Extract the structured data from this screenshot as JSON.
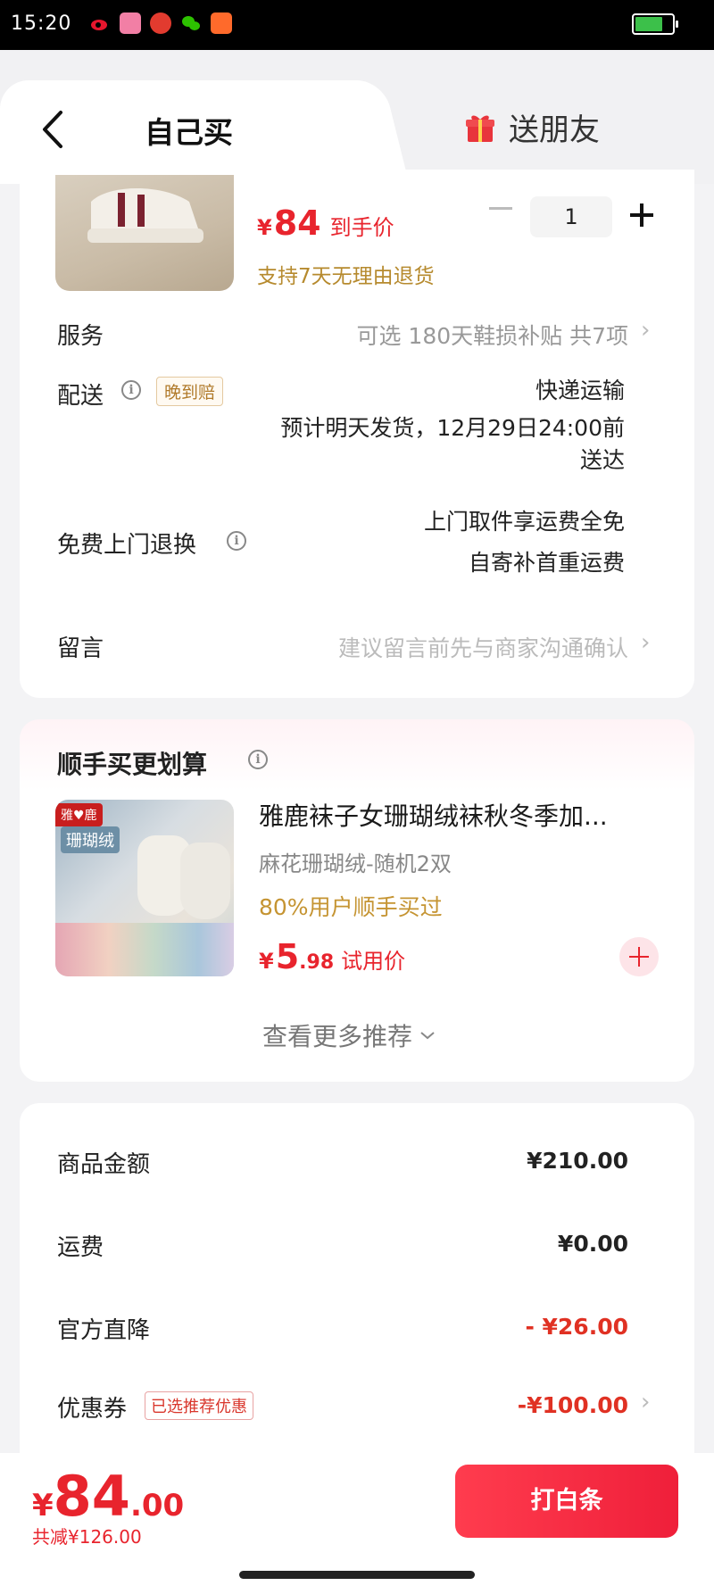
{
  "status_bar": {
    "time": "15:20"
  },
  "header": {
    "tab_self": "自己买",
    "tab_gift": "送朋友"
  },
  "product": {
    "price_currency": "¥",
    "price": "84",
    "price_label": "到手价",
    "return_tip": "支持7天无理由退货",
    "quantity": "1"
  },
  "service": {
    "label": "服务",
    "value": "可选  180天鞋损补贴 共7项"
  },
  "delivery": {
    "label": "配送",
    "late_tag": "晚到赔",
    "method": "快递运输",
    "eta_line1": "预计明天发货，12月29日24:00前",
    "eta_line2": "送达"
  },
  "free_return": {
    "label": "免费上门退换",
    "line1": "上门取件享运费全免",
    "line2": "自寄补首重运费"
  },
  "message": {
    "label": "留言",
    "placeholder": "建议留言前先与商家沟通确认"
  },
  "recommend": {
    "title": "顺手买更划算",
    "image_brand": "雅♥鹿",
    "image_badge": "珊瑚绒",
    "name": "雅鹿袜子女珊瑚绒袜秋冬季加...",
    "spec": "麻花珊瑚绒-随机2双",
    "bought": "80%用户顺手买过",
    "price_currency": "¥",
    "price_int": "5",
    "price_dec": ".98",
    "price_label": "试用价",
    "more": "查看更多推荐"
  },
  "fees": {
    "goods_label": "商品金额",
    "goods_value": "¥210.00",
    "shipping_label": "运费",
    "shipping_value": "¥0.00",
    "official_label": "官方直降",
    "official_value": "- ¥26.00",
    "coupon_label": "优惠券",
    "coupon_tag": "已选推荐优惠",
    "coupon_value": "-¥100.00"
  },
  "footer": {
    "total_currency": "¥",
    "total_int": "84",
    "total_dec": ".00",
    "total_saved": "共减¥126.00",
    "pay_button": "打白条"
  },
  "colors": {
    "accent_red": "#e8242d",
    "gold": "#c59432",
    "pay_button": "#f02a40"
  }
}
